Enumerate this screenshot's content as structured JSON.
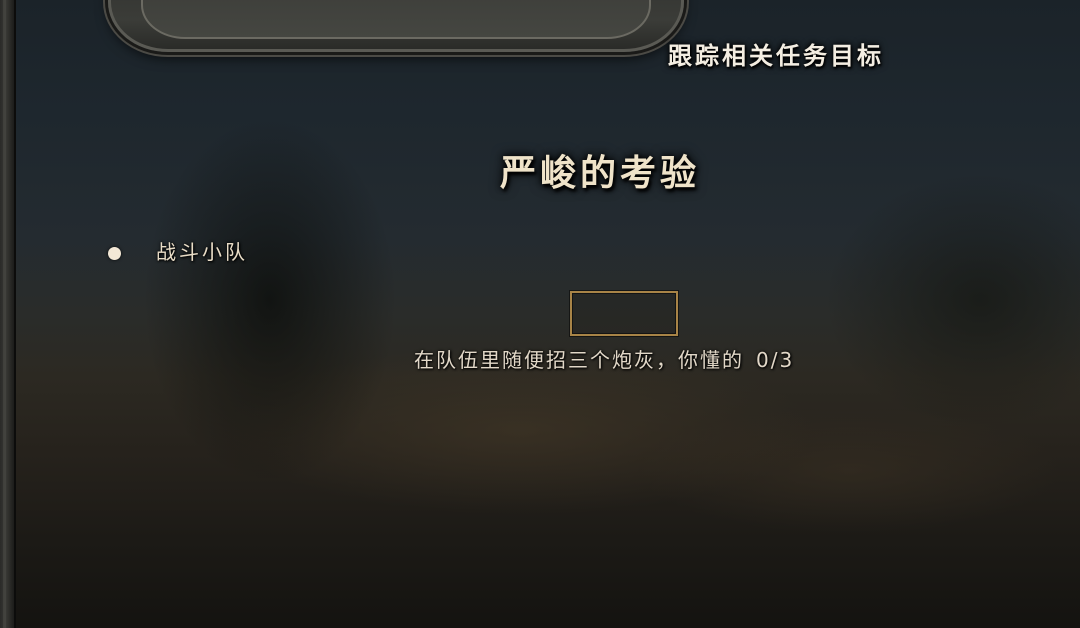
{
  "header": {
    "track_label": "跟踪相关任务目标"
  },
  "quest": {
    "title": "严峻的考验",
    "list_items": [
      {
        "label": "战斗小队"
      }
    ],
    "objective": {
      "text": "在队伍里随便招三个炮灰，你懂的",
      "progress": "0/3"
    }
  },
  "colors": {
    "title_text": "#efe3c9",
    "objective_box_border": "#a88447",
    "bullet": "#f3e8d6"
  }
}
